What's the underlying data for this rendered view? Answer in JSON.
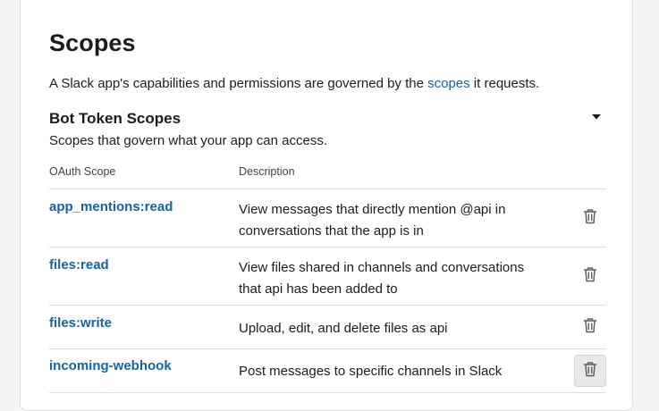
{
  "page": {
    "title": "Scopes",
    "intro_before": "A Slack app's capabilities and permissions are governed by the ",
    "intro_link": "scopes",
    "intro_after": " it requests."
  },
  "bot_scopes": {
    "title": "Bot Token Scopes",
    "subtitle": "Scopes that govern what your app can access.",
    "toggle_icon": "caret-down-icon",
    "columns": {
      "scope": "OAuth Scope",
      "description": "Description"
    },
    "rows": [
      {
        "scope": "app_mentions:read",
        "description": "View messages that directly mention @api in conversations that the app is in"
      },
      {
        "scope": "files:read",
        "description": "View files shared in channels and conversations that api has been added to"
      },
      {
        "scope": "files:write",
        "description": "Upload, edit, and delete files as api"
      },
      {
        "scope": "incoming-webhook",
        "description": "Post messages to specific channels in Slack"
      }
    ],
    "delete_icon": "trash-icon"
  },
  "colors": {
    "link": "#1264a3",
    "text": "#1d1c1d",
    "border": "#dddddd",
    "hover_bg": "#e8e8e8"
  }
}
